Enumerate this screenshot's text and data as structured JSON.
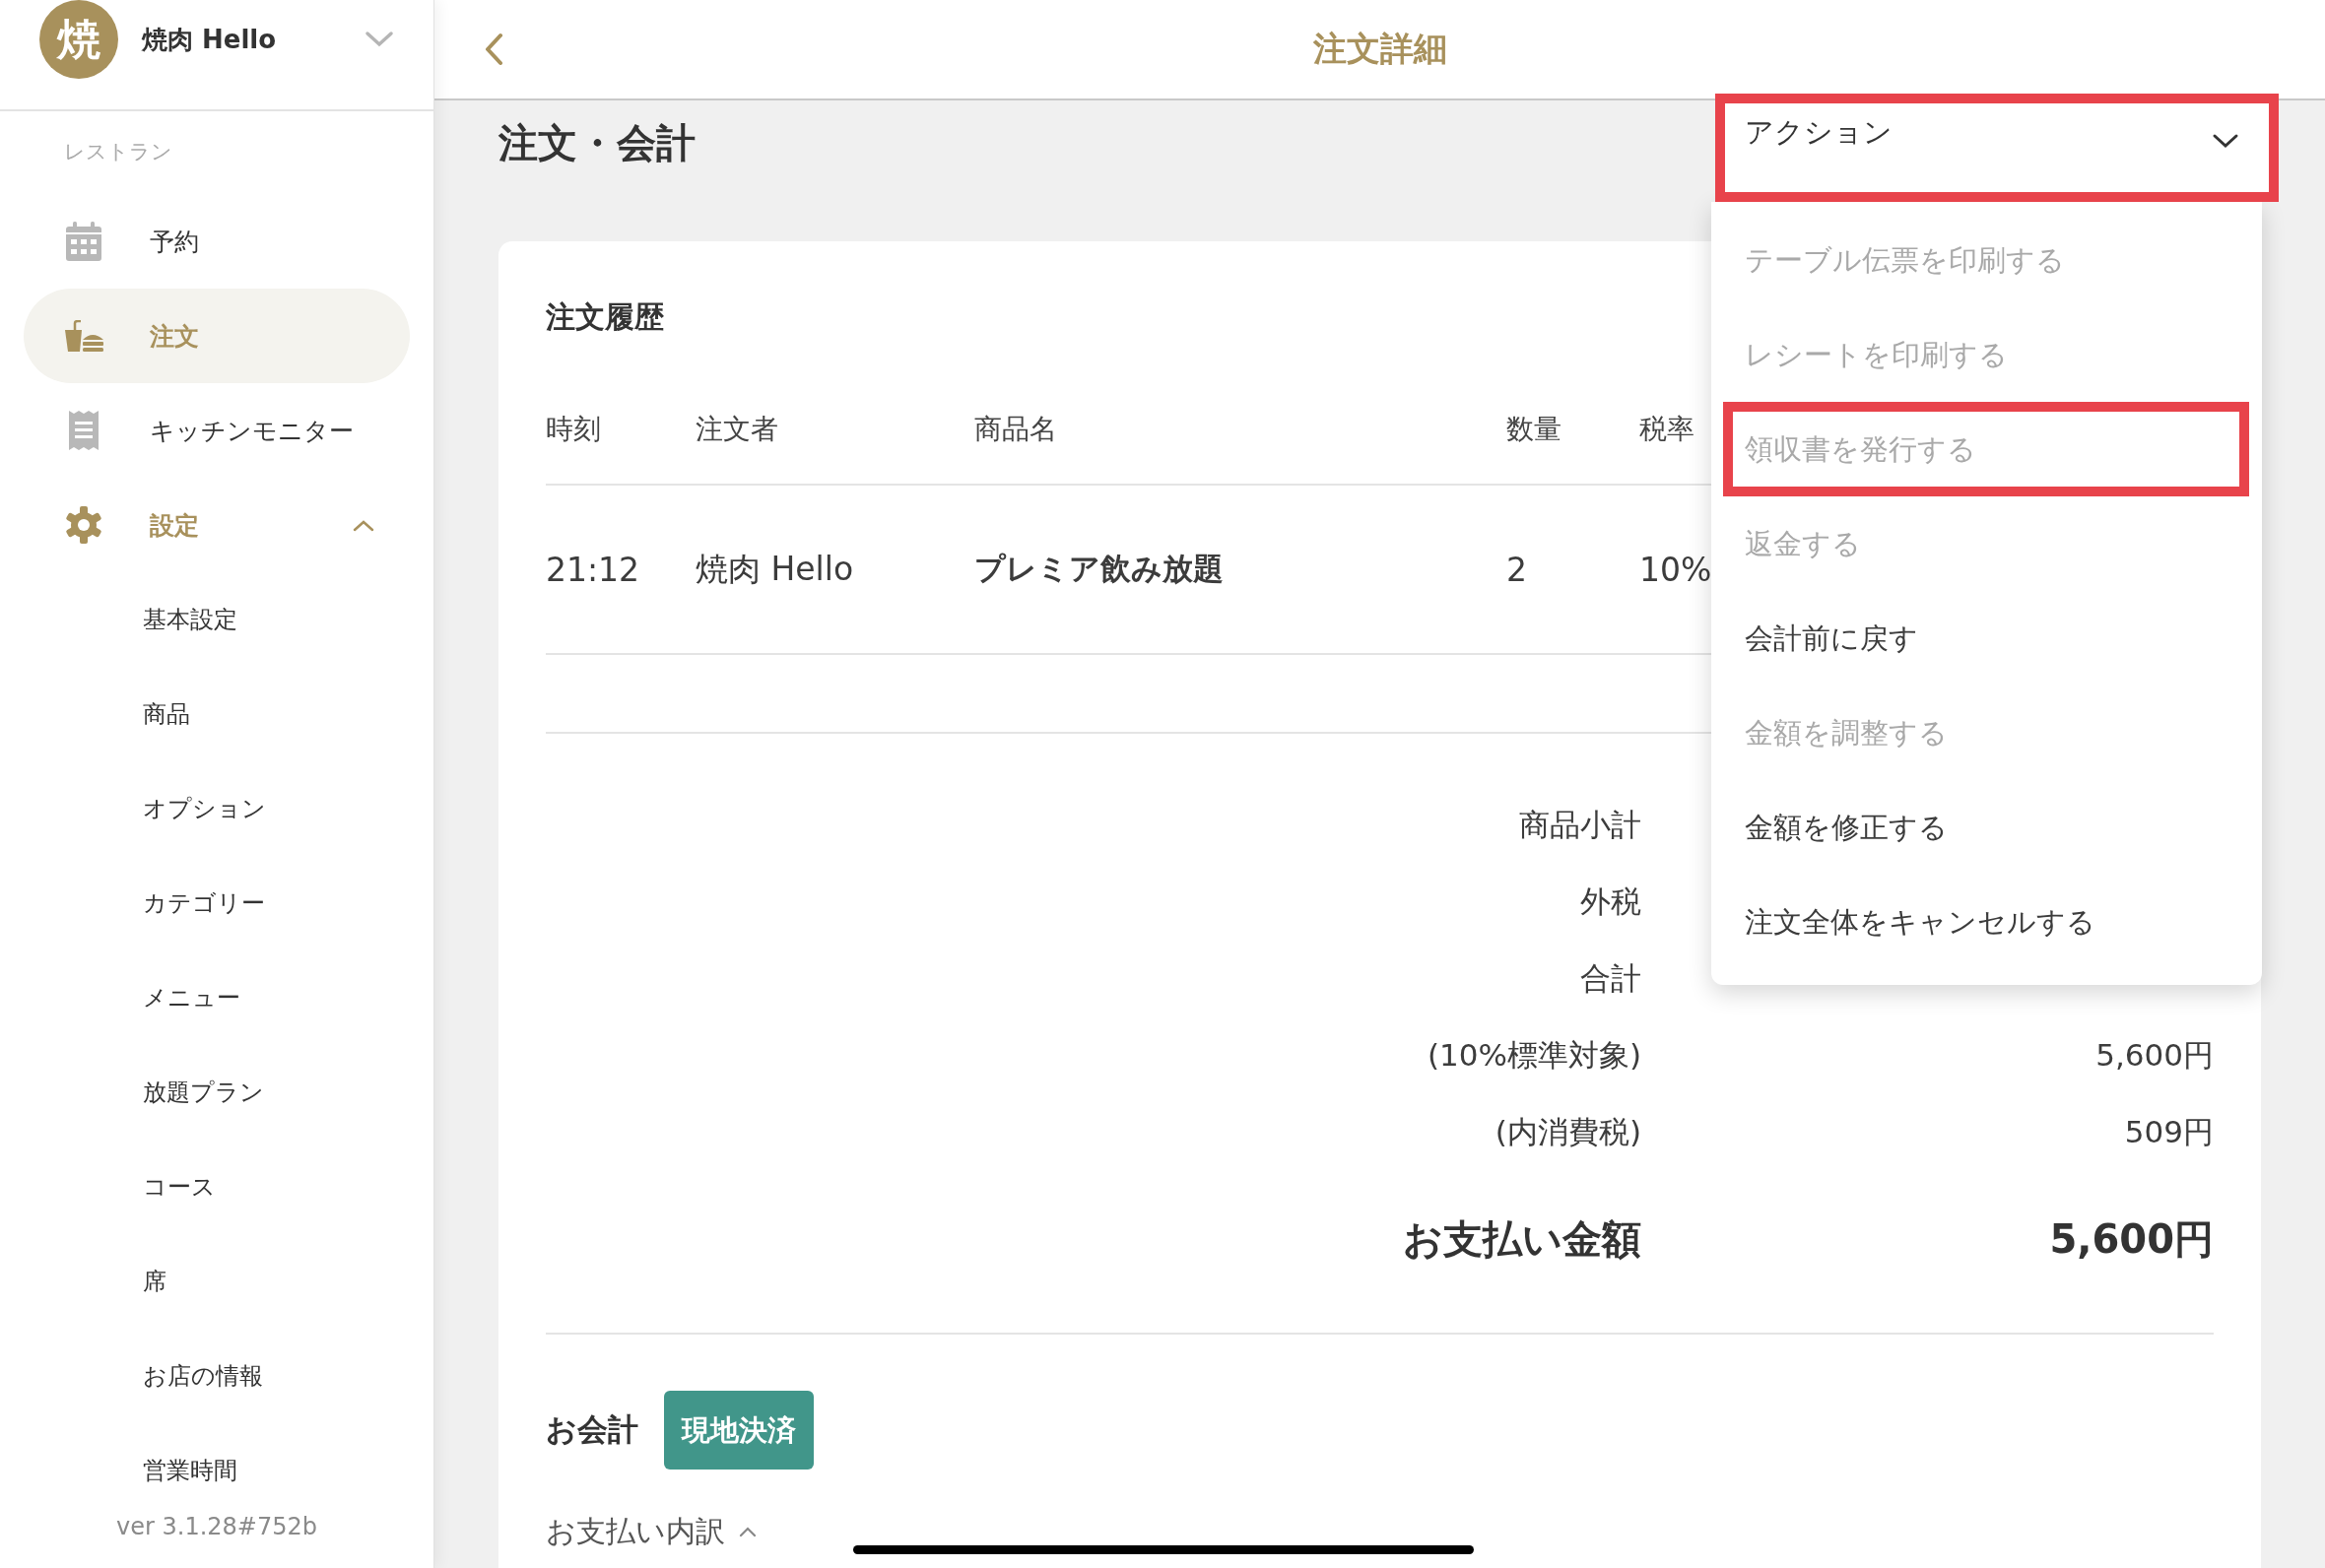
{
  "sidebar": {
    "restaurant": {
      "avatar": "焼",
      "name": "焼肉 Hello"
    },
    "section_label": "レストラン",
    "items": [
      {
        "label": "予約",
        "selected": false
      },
      {
        "label": "注文",
        "selected": true
      },
      {
        "label": "キッチンモニター",
        "selected": false
      },
      {
        "label": "設定",
        "selected": false,
        "expanded": true,
        "children": [
          {
            "label": "基本設定",
            "selected": false
          },
          {
            "label": "商品",
            "selected": false
          },
          {
            "label": "オプション",
            "selected": false
          },
          {
            "label": "カテゴリー",
            "selected": false
          },
          {
            "label": "メニュー",
            "selected": false
          },
          {
            "label": "放題プラン",
            "selected": false
          },
          {
            "label": "コース",
            "selected": false
          },
          {
            "label": "席",
            "selected": false
          },
          {
            "label": "お店の情報",
            "selected": false
          },
          {
            "label": "営業時間",
            "selected": false
          }
        ]
      }
    ],
    "version": "ver 3.1.28#752b"
  },
  "header": {
    "title": "注文詳細"
  },
  "page_title": "注文・会計",
  "order_history": {
    "title": "注文履歴",
    "columns": [
      "時刻",
      "注文者",
      "商品名",
      "数量",
      "税率"
    ],
    "rows": [
      {
        "time": "21:12",
        "orderer": "焼肉 Hello",
        "product": "プレミア飲み放題",
        "quantity": "2",
        "tax_rate": "10%"
      }
    ]
  },
  "totals": [
    {
      "label": "商品小計"
    },
    {
      "label": "外税"
    },
    {
      "label": "合計"
    },
    {
      "label": "(10%標準対象)",
      "value": "5,600円"
    },
    {
      "label": "(内消費税)",
      "value": "509円"
    }
  ],
  "payment_total": {
    "label": "お支払い金額",
    "value": "5,600円"
  },
  "payment": {
    "label": "お会計",
    "badge": "現地決済",
    "breakdown": "お支払い内訳",
    "breakdown_expanded": true
  },
  "action_menu": {
    "label": "アクション",
    "highlighted": true,
    "items": [
      {
        "label": "テーブル伝票を印刷する",
        "disabled": true,
        "highlighted": false
      },
      {
        "label": "レシートを印刷する",
        "disabled": true,
        "highlighted": false
      },
      {
        "label": "領収書を発行する",
        "disabled": true,
        "highlighted": true
      },
      {
        "label": "返金する",
        "disabled": true,
        "highlighted": false
      },
      {
        "label": "会計前に戻す",
        "disabled": false,
        "highlighted": false
      },
      {
        "label": "金額を調整する",
        "disabled": true,
        "highlighted": false
      },
      {
        "label": "金額を修正する",
        "disabled": false,
        "highlighted": false
      },
      {
        "label": "注文全体をキャンセルする",
        "disabled": false,
        "highlighted": false
      }
    ]
  }
}
